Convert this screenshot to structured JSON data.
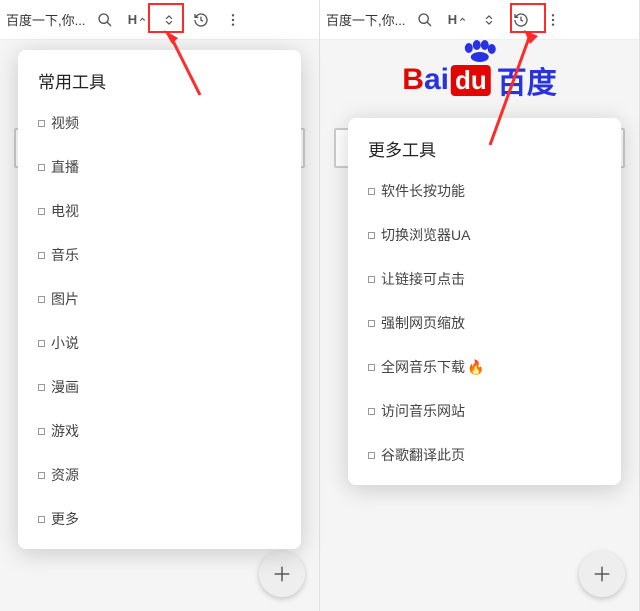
{
  "colors": {
    "highlight": "#ff2a2a",
    "baidu_red": "#e10601",
    "baidu_blue": "#2932e1"
  },
  "logo": {
    "b": "B",
    "ai": "ai",
    "du": "du",
    "cn": "百度"
  },
  "left": {
    "topbar_title": "百度一下,你...",
    "popup_title": "常用工具",
    "items": [
      {
        "label": "视频"
      },
      {
        "label": "直播"
      },
      {
        "label": "电视"
      },
      {
        "label": "音乐"
      },
      {
        "label": "图片"
      },
      {
        "label": "小说"
      },
      {
        "label": "漫画"
      },
      {
        "label": "游戏"
      },
      {
        "label": "资源"
      },
      {
        "label": "更多"
      }
    ]
  },
  "right": {
    "topbar_title": "百度一下,你...",
    "popup_title": "更多工具",
    "items": [
      {
        "label": "软件长按功能"
      },
      {
        "label": "切换浏览器UA"
      },
      {
        "label": "让链接可点击"
      },
      {
        "label": "强制网页缩放"
      },
      {
        "label": "全网音乐下载",
        "fire": "🔥"
      },
      {
        "label": "访问音乐网站"
      },
      {
        "label": "谷歌翻译此页"
      }
    ]
  }
}
